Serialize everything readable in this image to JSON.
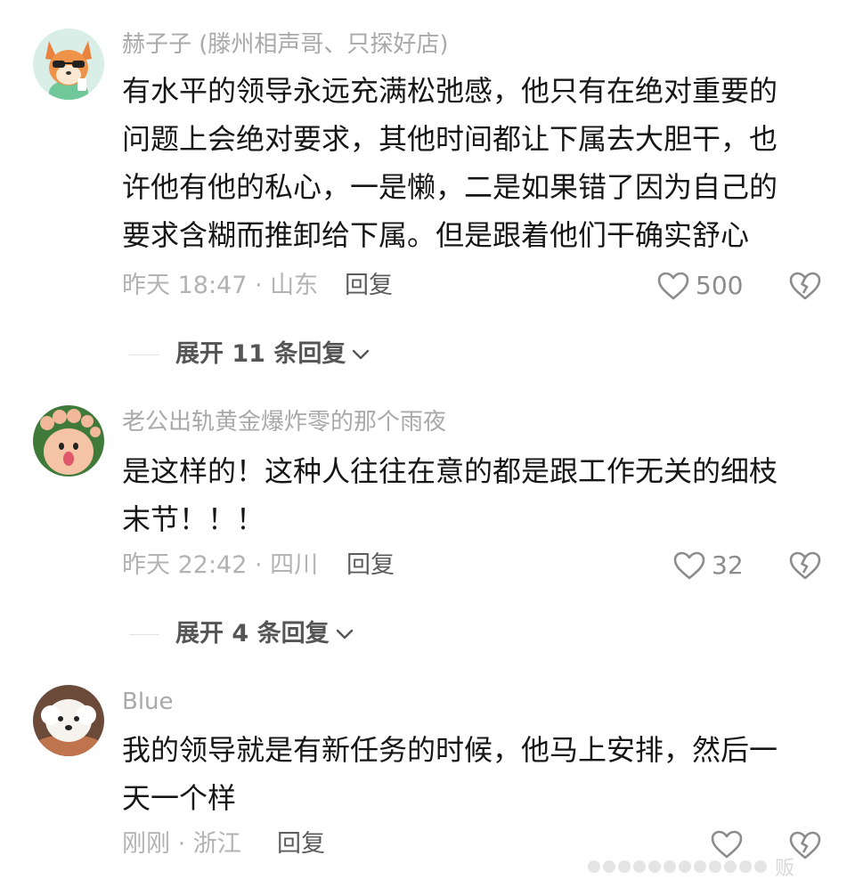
{
  "comments": [
    {
      "username": "赫子子 (滕州相声哥、只探好店)",
      "lines": [
        "有水平的领导永远充满松弛感，他只有在绝对重要的",
        "问题上会绝对要求，其他时间都让下属去大胆干，也",
        "许他有他的私心，一是懒，二是如果错了因为自己的",
        "要求含糊而推卸给下属。但是跟着他们干确实舒心"
      ],
      "meta": "昨天 18:47 · 山东",
      "reply_label": "回复",
      "like_count": "500",
      "expand_label": "展开 11 条回复",
      "avatar_icon": "fox-avatar"
    },
    {
      "username": "老公出轨黄金爆炸零的那个雨夜",
      "lines": [
        "是这样的！这种人往往在意的都是跟工作无关的细枝",
        "末节！！！"
      ],
      "meta": "昨天 22:42 · 四川",
      "reply_label": "回复",
      "like_count": "32",
      "expand_label": "展开 4 条回复",
      "avatar_icon": "foot-avatar"
    },
    {
      "username": "Blue",
      "lines": [
        "我的领导就是有新任务的时候，他马上安排，然后一",
        "天一个样"
      ],
      "meta": "刚刚 · 浙江",
      "reply_label": "回复",
      "like_count": "",
      "avatar_icon": "dog-avatar"
    }
  ],
  "colors": {
    "text": "#161616",
    "muted": "#a9a9a9",
    "reply": "#5c5c5c"
  },
  "watermark": "贩"
}
